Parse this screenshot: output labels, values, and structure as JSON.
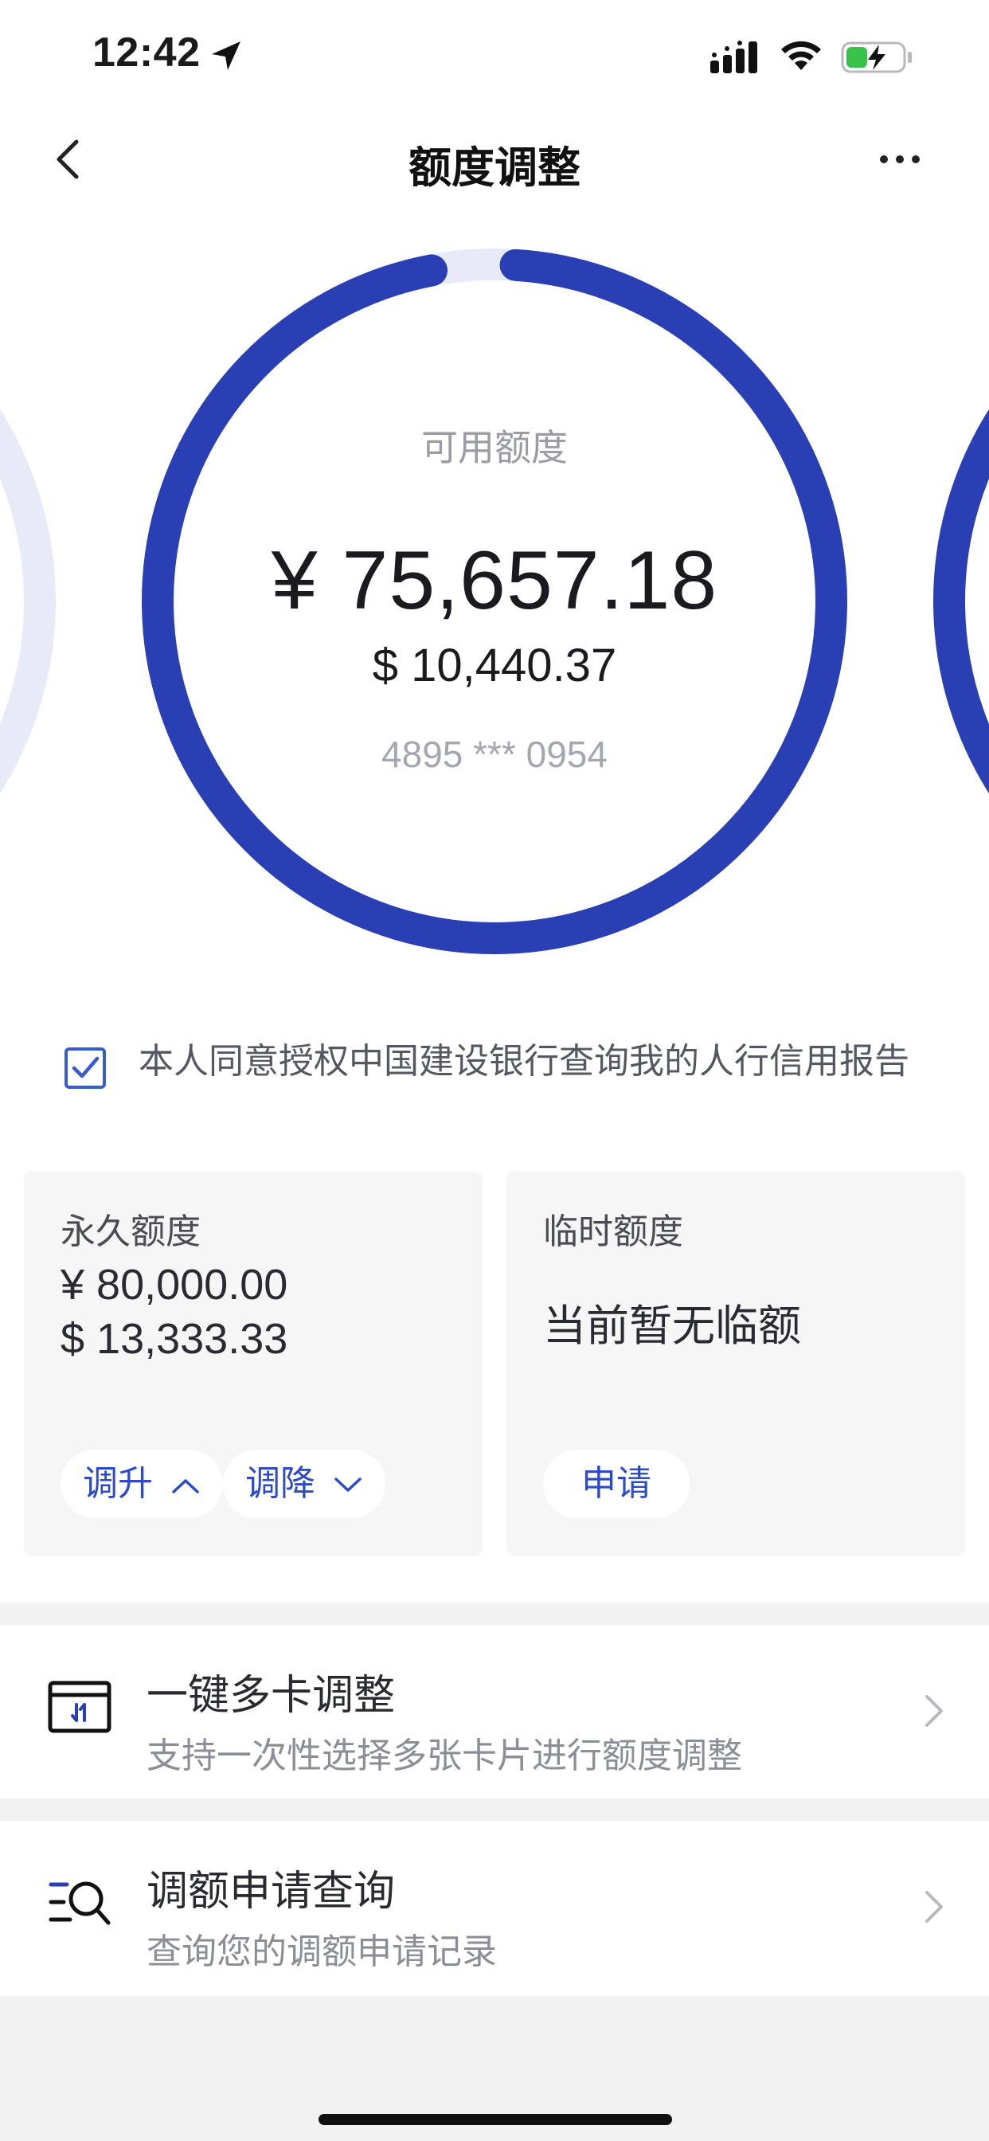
{
  "status_bar": {
    "time": "12:42"
  },
  "nav": {
    "title": "额度调整"
  },
  "available": {
    "label": "可用额度",
    "amount_cny": "¥ 75,657.18",
    "amount_usd": "$ 10,440.37",
    "card_number": "4895 *** 0954",
    "used_fraction": 0.96
  },
  "consent": {
    "text": "本人同意授权中国建设银行查询我的人行信用报告",
    "checked": true
  },
  "permanent_quota": {
    "title": "永久额度",
    "amount_cny": "¥  80,000.00",
    "amount_usd": "$  13,333.33",
    "increase_label": "调升",
    "decrease_label": "调降"
  },
  "temporary_quota": {
    "title": "临时额度",
    "status": "当前暂无临额",
    "apply_label": "申请"
  },
  "list": [
    {
      "title": "一键多卡调整",
      "subtitle": "支持一次性选择多张卡片进行额度调整",
      "icon": "card-adjust-icon"
    },
    {
      "title": "调额申请查询",
      "subtitle": "查询您的调额申请记录",
      "icon": "search-list-icon"
    }
  ],
  "colors": {
    "primary": "#2a3fb4",
    "ring_track": "#e8eaf8",
    "link": "#2d4bc5"
  }
}
